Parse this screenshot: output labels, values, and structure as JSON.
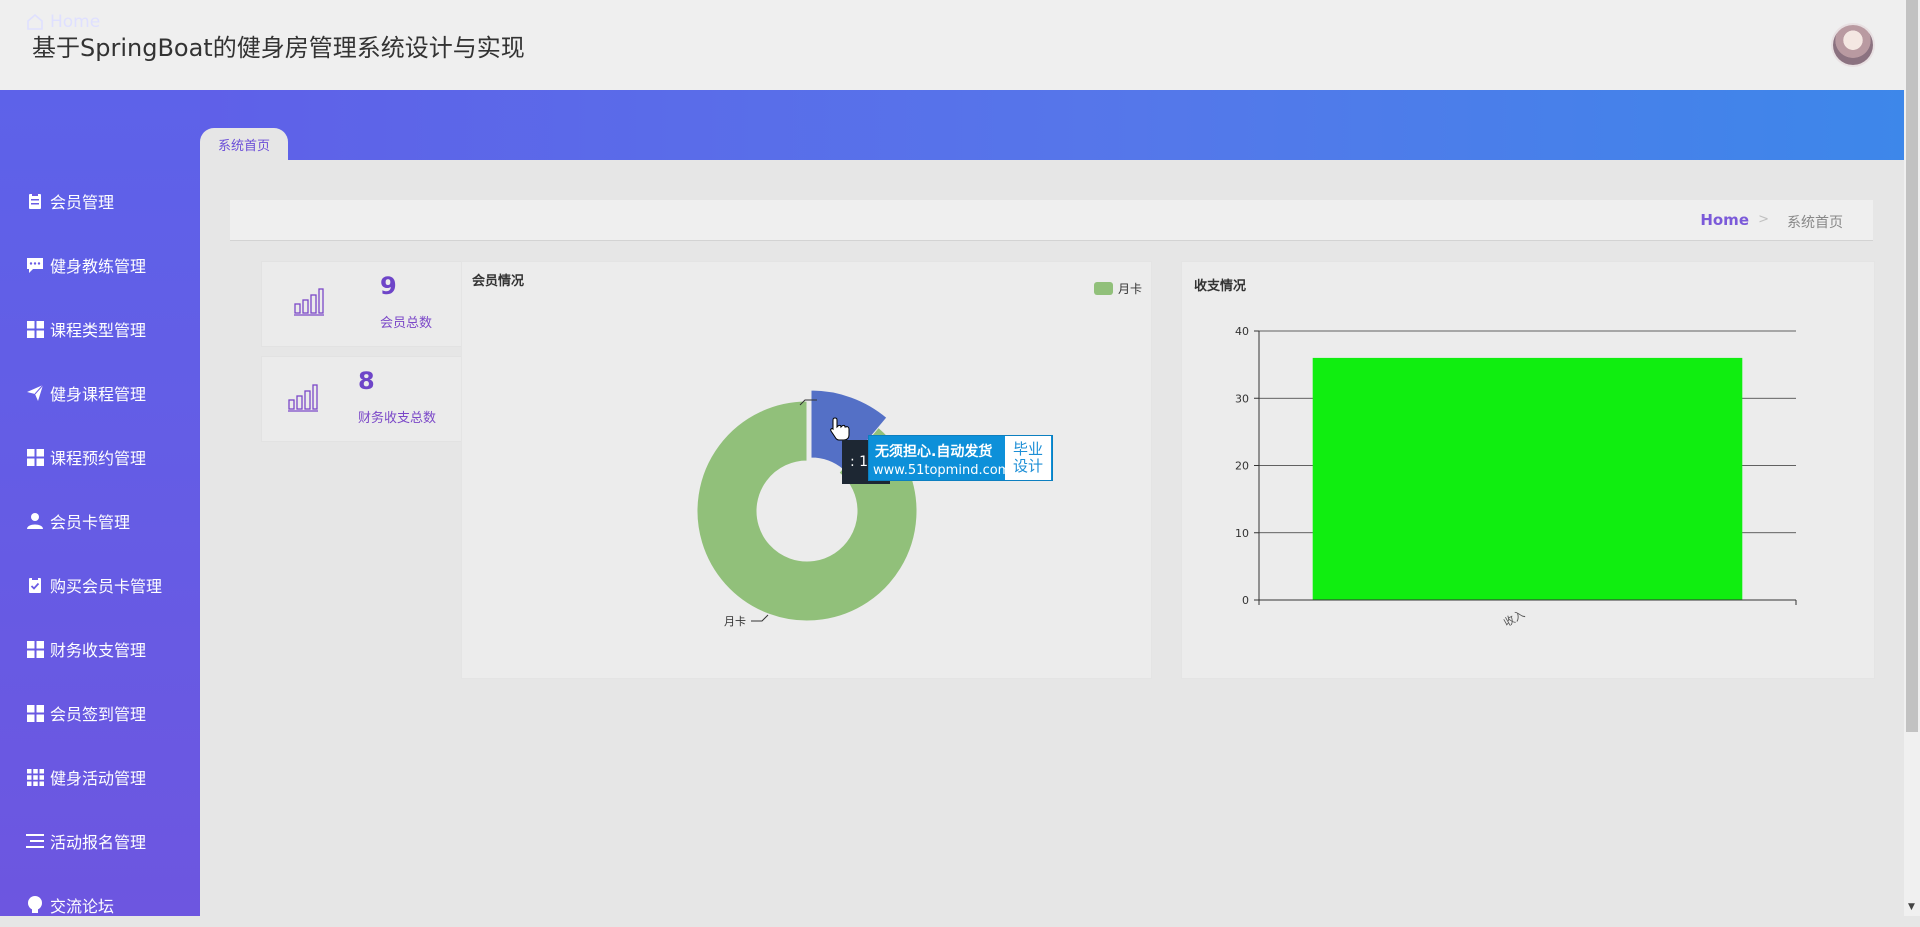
{
  "header": {
    "title": "基于SpringBoat的健身房管理系统设计与实现"
  },
  "sidebar": {
    "items": [
      {
        "label": "Home",
        "icon": "home-icon"
      },
      {
        "label": "会员管理",
        "icon": "clipboard-icon"
      },
      {
        "label": "健身教练管理",
        "icon": "chat-icon"
      },
      {
        "label": "课程类型管理",
        "icon": "grid-icon"
      },
      {
        "label": "健身课程管理",
        "icon": "send-icon"
      },
      {
        "label": "课程预约管理",
        "icon": "grid-icon"
      },
      {
        "label": "会员卡管理",
        "icon": "user-icon"
      },
      {
        "label": "购买会员卡管理",
        "icon": "clipboard-check-icon"
      },
      {
        "label": "财务收支管理",
        "icon": "grid-icon"
      },
      {
        "label": "会员签到管理",
        "icon": "grid-icon"
      },
      {
        "label": "健身活动管理",
        "icon": "apps-icon"
      },
      {
        "label": "活动报名管理",
        "icon": "list-icon"
      },
      {
        "label": "交流论坛",
        "icon": "bulb-icon"
      }
    ]
  },
  "tabs": [
    {
      "label": "系统首页"
    }
  ],
  "breadcrumb": {
    "home": "Home",
    "separator": ">",
    "current": "系统首页"
  },
  "stats": [
    {
      "value": "9",
      "label": "会员总数"
    },
    {
      "value": "8",
      "label": "财务收支总数"
    }
  ],
  "pie_panel": {
    "title": "会员情况",
    "legend": "月卡",
    "slice_label": "月卡",
    "tooltip": ": 1"
  },
  "watermark": {
    "line1": "无须担心.自动发货",
    "line2": "www.51topmind.com",
    "right1": "毕业",
    "right2": "设计"
  },
  "bar_panel": {
    "title": "收支情况"
  },
  "colors": {
    "accent": "#6e45c8",
    "sidebar_top": "#5d62e9",
    "pie_main": "#91c07a",
    "pie_slice": "#5470c6",
    "bar": "#10ee10"
  },
  "chart_data": [
    {
      "type": "pie",
      "title": "会员情况",
      "labels": [
        "月卡",
        ""
      ],
      "values": [
        8,
        1
      ],
      "colors": [
        "#91c07a",
        "#5470c6"
      ]
    },
    {
      "type": "bar",
      "title": "收支情况",
      "categories": [
        "收入"
      ],
      "values": [
        36
      ],
      "ylim": [
        0,
        40
      ],
      "yticks": [
        0,
        10,
        20,
        30,
        40
      ],
      "grid": true
    }
  ]
}
